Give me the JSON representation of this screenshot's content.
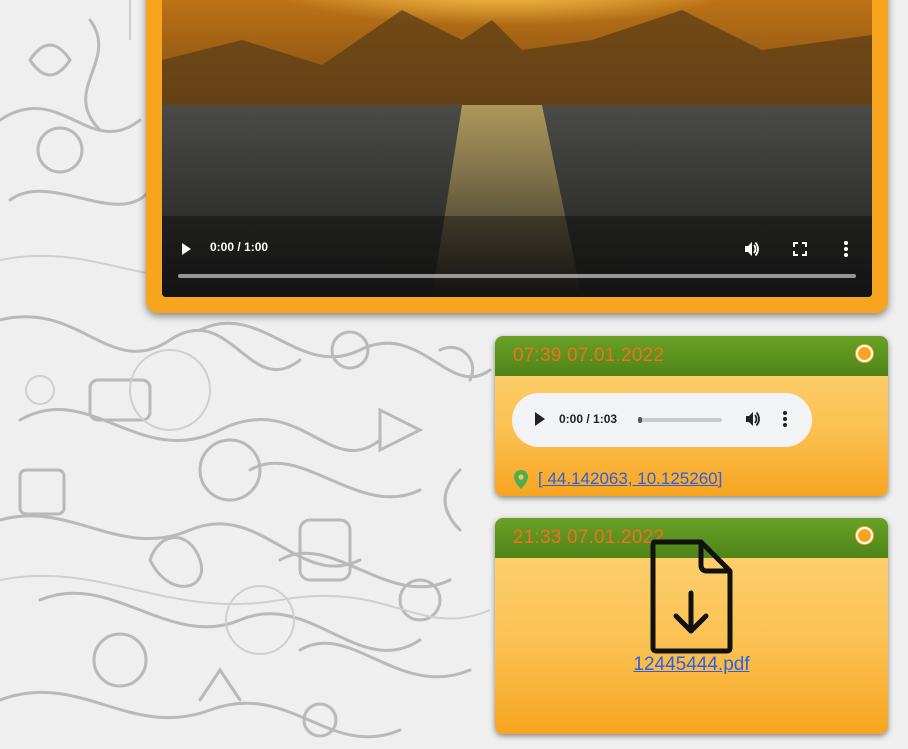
{
  "video": {
    "time": "0:00 / 1:00",
    "progress": 0,
    "icons": [
      "play-icon",
      "volume-icon",
      "fullscreen-icon",
      "more-vert-icon"
    ]
  },
  "messages": [
    {
      "time": "07:39 07.01.2022",
      "type": "audio",
      "audio": {
        "time": "0:00 / 1:03",
        "progress": 0
      },
      "location": "[ 44.142063, 10.125260]"
    },
    {
      "time": "21:33 07.01.2022",
      "type": "file",
      "file_name": "12445444.pdf"
    }
  ],
  "colors": {
    "card_orange": "#f7a51f",
    "header_green": "#5a8f1d",
    "time_text": "#f26f21",
    "link_blue": "#2d5fe0",
    "pin_green": "#4caf50"
  }
}
